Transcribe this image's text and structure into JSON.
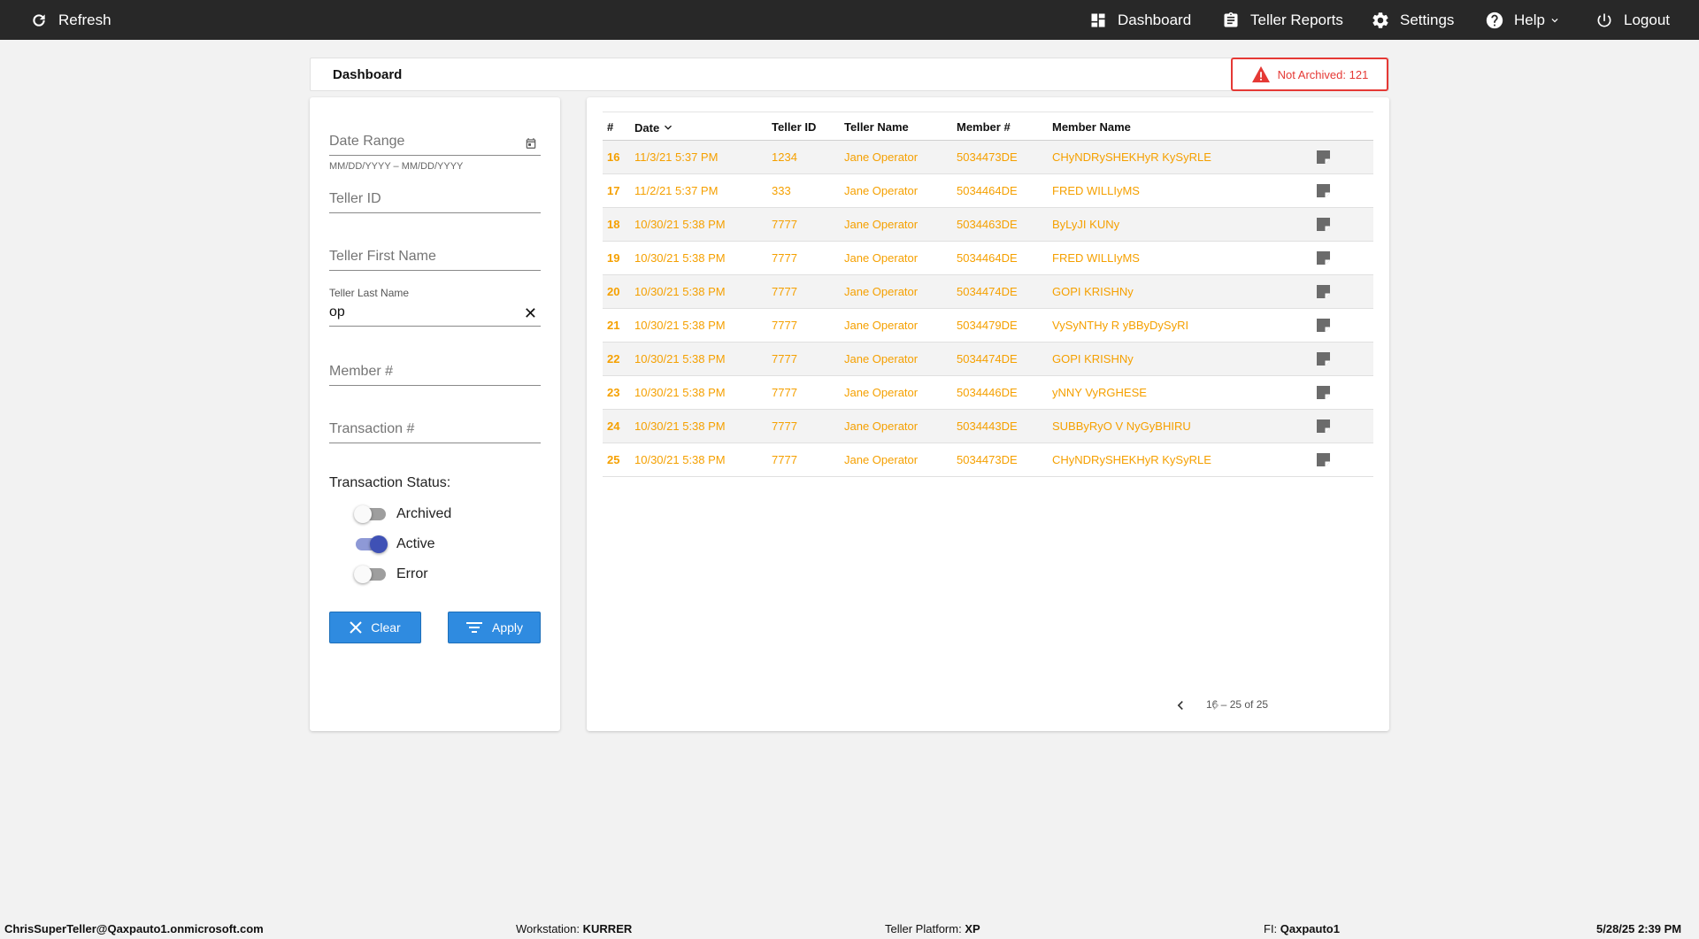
{
  "topbar": {
    "refresh_label": "Refresh",
    "dashboard_label": "Dashboard",
    "teller_reports_label": "Teller Reports",
    "settings_label": "Settings",
    "help_label": "Help",
    "logout_label": "Logout"
  },
  "header": {
    "title": "Dashboard",
    "alert_label": "Not Archived:",
    "alert_count": "121",
    "alert_color": "#e53935"
  },
  "filters": {
    "date_range_placeholder": "Date Range",
    "date_range_hint": "MM/DD/YYYY – MM/DD/YYYY",
    "teller_id_placeholder": "Teller ID",
    "teller_first_name_placeholder": "Teller First Name",
    "teller_last_name_label": "Teller Last Name",
    "teller_last_name_value": "op",
    "member_placeholder": "Member #",
    "transaction_placeholder": "Transaction #",
    "status_title": "Transaction Status:",
    "statuses": [
      {
        "label": "Archived",
        "on": false
      },
      {
        "label": "Active",
        "on": true
      },
      {
        "label": "Error",
        "on": false
      }
    ],
    "clear_label": "Clear",
    "apply_label": "Apply"
  },
  "table": {
    "columns": [
      "#",
      "Date",
      "Teller ID",
      "Teller Name",
      "Member #",
      "Member Name"
    ],
    "sort_column": "Date",
    "rows": [
      {
        "num": "16",
        "date": "11/3/21 5:37 PM",
        "teller_id": "1234",
        "teller_name": "Jane Operator",
        "member": "5034473DE",
        "member_name": "CHyNDRySHEKHyR KySyRLE"
      },
      {
        "num": "17",
        "date": "11/2/21 5:37 PM",
        "teller_id": "333",
        "teller_name": "Jane Operator",
        "member": "5034464DE",
        "member_name": "FRED WILLIyMS"
      },
      {
        "num": "18",
        "date": "10/30/21 5:38 PM",
        "teller_id": "7777",
        "teller_name": "Jane Operator",
        "member": "5034463DE",
        "member_name": "ByLyJI KUNy"
      },
      {
        "num": "19",
        "date": "10/30/21 5:38 PM",
        "teller_id": "7777",
        "teller_name": "Jane Operator",
        "member": "5034464DE",
        "member_name": "FRED WILLIyMS"
      },
      {
        "num": "20",
        "date": "10/30/21 5:38 PM",
        "teller_id": "7777",
        "teller_name": "Jane Operator",
        "member": "5034474DE",
        "member_name": "GOPI KRISHNy"
      },
      {
        "num": "21",
        "date": "10/30/21 5:38 PM",
        "teller_id": "7777",
        "teller_name": "Jane Operator",
        "member": "5034479DE",
        "member_name": "VySyNTHy R yBByDySyRI"
      },
      {
        "num": "22",
        "date": "10/30/21 5:38 PM",
        "teller_id": "7777",
        "teller_name": "Jane Operator",
        "member": "5034474DE",
        "member_name": "GOPI KRISHNy"
      },
      {
        "num": "23",
        "date": "10/30/21 5:38 PM",
        "teller_id": "7777",
        "teller_name": "Jane Operator",
        "member": "5034446DE",
        "member_name": "yNNY VyRGHESE"
      },
      {
        "num": "24",
        "date": "10/30/21 5:38 PM",
        "teller_id": "7777",
        "teller_name": "Jane Operator",
        "member": "5034443DE",
        "member_name": "SUBByRyO V NyGyBHIRU"
      },
      {
        "num": "25",
        "date": "10/30/21 5:38 PM",
        "teller_id": "7777",
        "teller_name": "Jane Operator",
        "member": "5034473DE",
        "member_name": "CHyNDRySHEKHyR KySyRLE"
      }
    ],
    "row_text_color": "#f5a000",
    "pager_range": "16 – 25 of 25"
  },
  "footer": {
    "user": "ChrisSuperTeller@Qaxpauto1.onmicrosoft.com",
    "workstation_label": "Workstation:",
    "workstation_value": "KURRER",
    "platform_label": "Teller Platform:",
    "platform_value": "XP",
    "fi_label": "FI:",
    "fi_value": "Qaxpauto1",
    "datetime": "5/28/25 2:39 PM"
  },
  "icons": {
    "refresh": "refresh-icon",
    "dashboard": "dashboard-icon",
    "reports": "clipboard-icon",
    "settings": "gear-icon",
    "help": "help-icon",
    "logout": "power-icon",
    "alert": "warning-icon",
    "note": "note-icon"
  }
}
